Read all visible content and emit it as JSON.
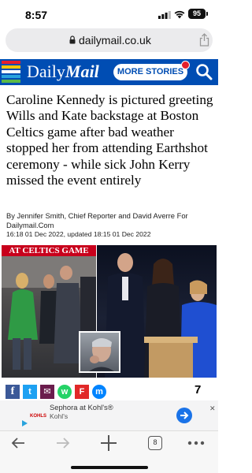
{
  "status": {
    "time": "8:57",
    "battery": "95"
  },
  "browser": {
    "url": "dailymail.co.uk",
    "tab_count": "8"
  },
  "site": {
    "logo_light": "Daily",
    "logo_bold": "Mail",
    "more_stories": "MORE STORIES",
    "brand_color": "#004db3"
  },
  "article": {
    "headline": "Caroline Kennedy is pictured greeting Wills and Kate backstage at Boston Celtics game after bad weather stopped her from attending Earthshot ceremony - while sick John Kerry missed the event entirely",
    "byline": "By Jennifer Smith, Chief Reporter and David Averre For Dailymail.Com",
    "dates": "16:18 01 Dec 2022, updated 18:15 01 Dec 2022",
    "image_caption": "AT CELTICS GAME",
    "share_count": "7"
  },
  "share": {
    "facebook": "f",
    "twitter": "t",
    "email": "✉",
    "whatsapp": "w",
    "flipboard": "F",
    "messenger": "m"
  },
  "ad": {
    "title": "Sephora at Kohl's®",
    "subtitle": "Kohl's",
    "logo_text": "KOHLS",
    "close": "✕"
  }
}
